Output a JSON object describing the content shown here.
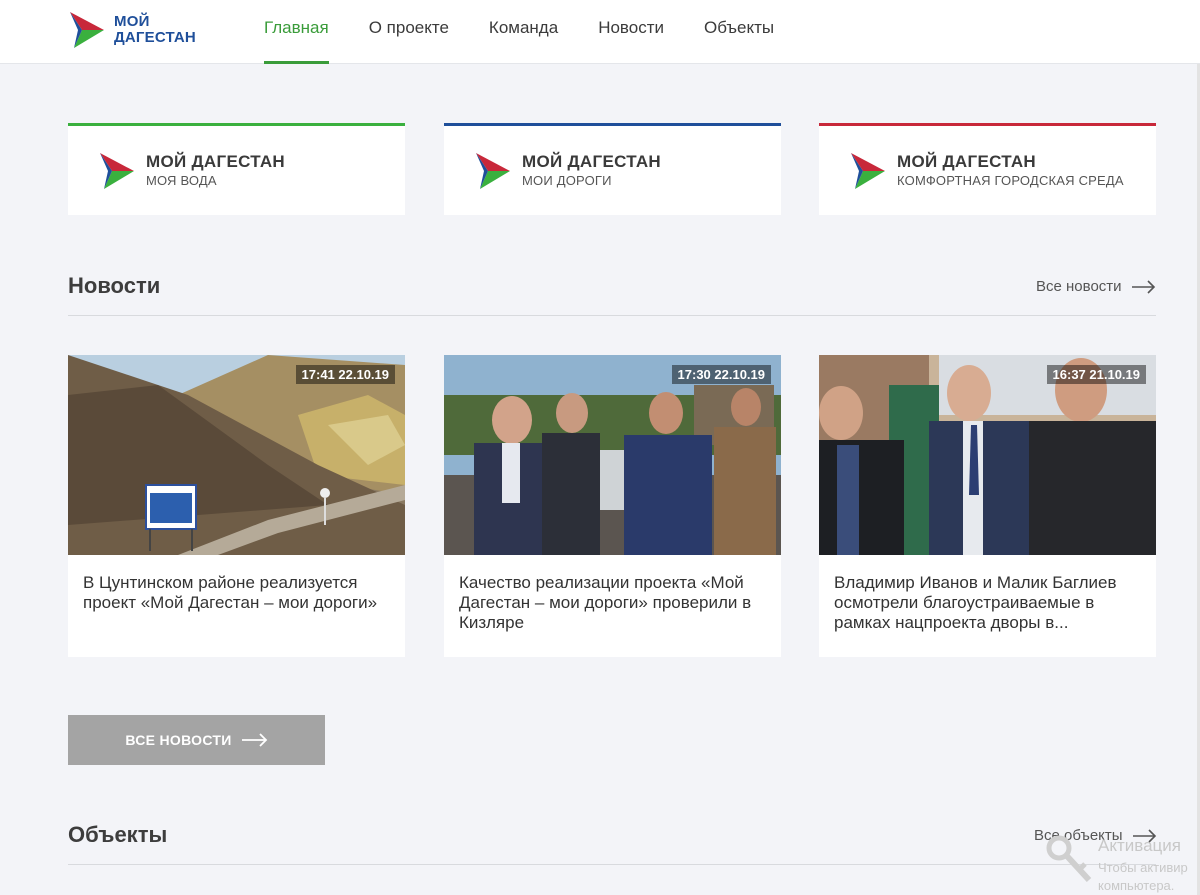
{
  "header": {
    "logo": {
      "line1": "МОЙ",
      "line2": "ДАГЕСТАН"
    },
    "nav": [
      {
        "label": "Главная",
        "active": true
      },
      {
        "label": "О проекте",
        "active": false
      },
      {
        "label": "Команда",
        "active": false
      },
      {
        "label": "Новости",
        "active": false
      },
      {
        "label": "Объекты",
        "active": false
      }
    ]
  },
  "projects": [
    {
      "title": "МОЙ ДАГЕСТАН",
      "subtitle": "МОЯ ВОДА",
      "accent": "#3ab03e"
    },
    {
      "title": "МОЙ ДАГЕСТАН",
      "subtitle": "МОИ ДОРОГИ",
      "accent": "#1f4f9a"
    },
    {
      "title": "МОЙ ДАГЕСТАН",
      "subtitle": "КОМФОРТНАЯ ГОРОДСКАЯ СРЕДА",
      "accent": "#c8283a"
    }
  ],
  "news": {
    "title": "Новости",
    "link": "Все новости",
    "items": [
      {
        "time": "17:41 22.10.19",
        "title": "В Цунтинском районе реализуется проект «Мой Дагестан – мои дороги»"
      },
      {
        "time": "17:30 22.10.19",
        "title": "Качество реализации проекта «Мой Дагестан – мои дороги» проверили в Кизляре"
      },
      {
        "time": "16:37 21.10.19",
        "title": "Владимир Иванов и Малик Баглиев осмотрели благоустраиваемые в рамках нацпроекта дворы в..."
      }
    ],
    "button": "ВСЕ НОВОСТИ"
  },
  "objects": {
    "title": "Объекты",
    "link": "Все объекты"
  },
  "watermark": {
    "line1": "Активация",
    "line2": "Чтобы активир",
    "line3": "компьютера."
  },
  "colors": {
    "accent_green": "#3a9c3a",
    "brand_blue": "#1f4f9a",
    "brand_red": "#c8283a",
    "button_gray": "#a4a4a4"
  }
}
